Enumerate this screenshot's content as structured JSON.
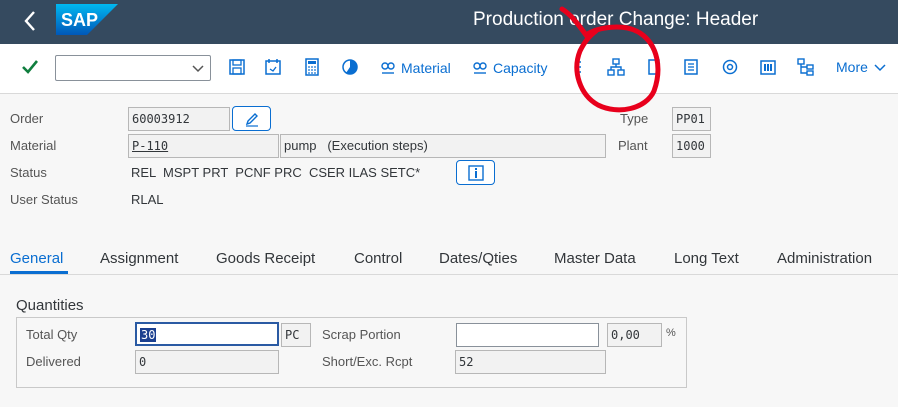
{
  "shell": {
    "logo_text": "SAP",
    "title": "Production order Change: Header"
  },
  "toolbar": {
    "dropdown_value": "",
    "material_label": "Material",
    "capacity_label": "Capacity",
    "more_label": "More"
  },
  "header": {
    "order_label": "Order",
    "order_value": "60003912",
    "type_label": "Type",
    "type_value": "PP01",
    "material_label": "Material",
    "material_value": "P-110",
    "material_desc": "pump   (Execution steps)",
    "plant_label": "Plant",
    "plant_value": "1000",
    "status_label": "Status",
    "status_value": "REL  MSPT PRT  PCNF PRC  CSER ILAS SETC*",
    "user_status_label": "User Status",
    "user_status_value": "RLAL"
  },
  "tabs": [
    {
      "label": "General",
      "active": true
    },
    {
      "label": "Assignment"
    },
    {
      "label": "Goods Receipt"
    },
    {
      "label": "Control"
    },
    {
      "label": "Dates/Qties"
    },
    {
      "label": "Master Data"
    },
    {
      "label": "Long Text"
    },
    {
      "label": "Administration"
    }
  ],
  "quantities": {
    "title": "Quantities",
    "total_qty_label": "Total Qty",
    "total_qty_value": "30",
    "unit_value": "PC",
    "scrap_label": "Scrap Portion",
    "scrap_value": "",
    "scrap_pct_value": "0,00",
    "pct_symbol": "%",
    "delivered_label": "Delivered",
    "delivered_value": "0",
    "short_exc_label": "Short/Exc. Rcpt",
    "short_exc_value": "52"
  },
  "colors": {
    "shell_bg": "#354a5f",
    "accent": "#0a6ed1",
    "annotation": "#e8001c"
  }
}
